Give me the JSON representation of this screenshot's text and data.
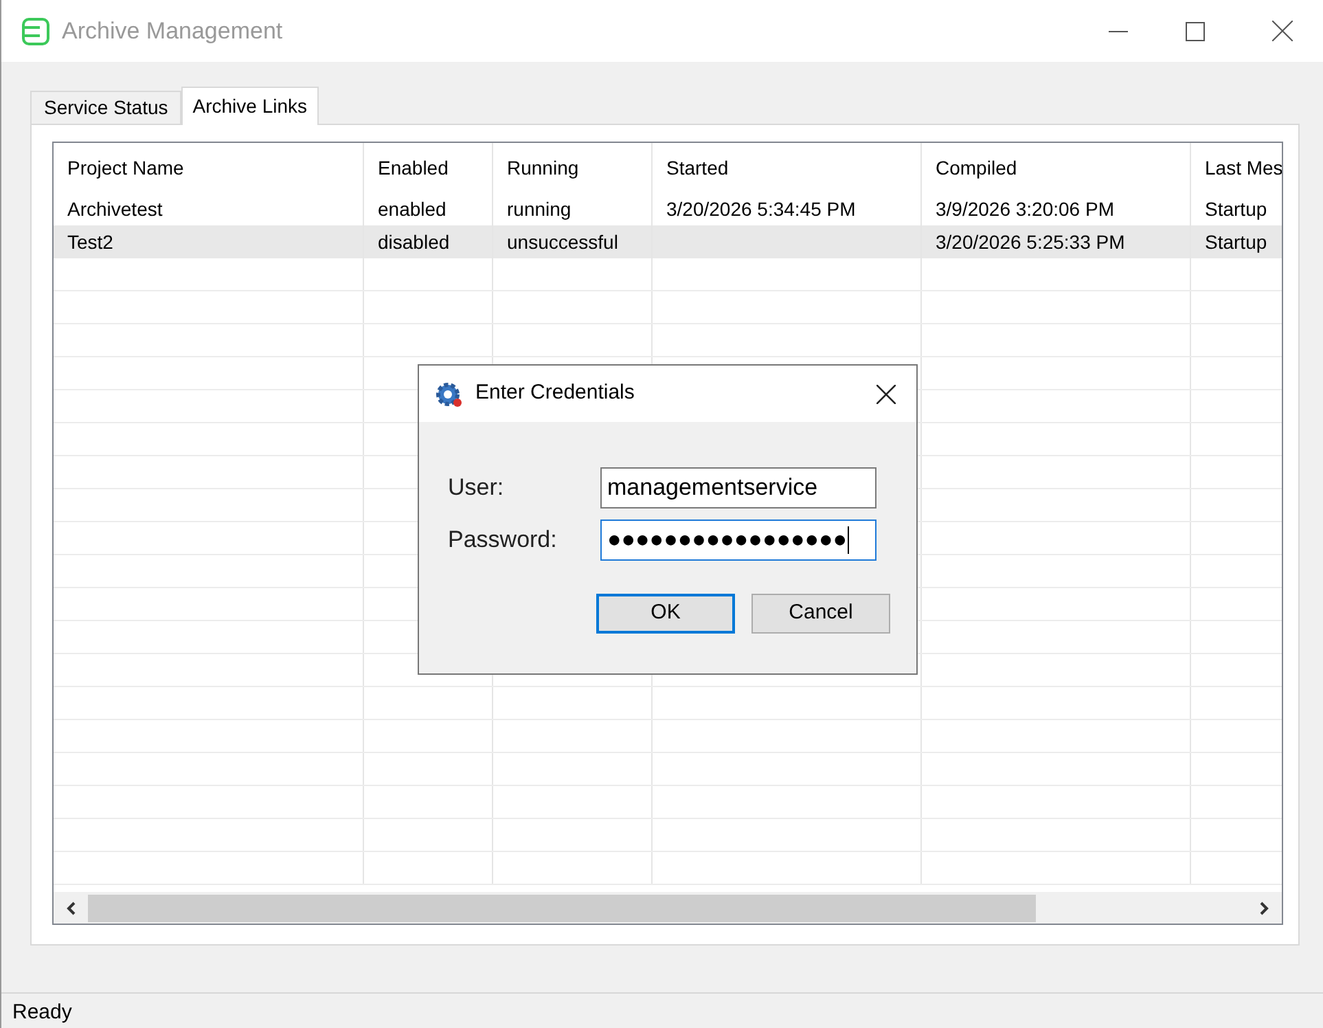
{
  "window": {
    "title": "Archive Management"
  },
  "tabs": [
    {
      "label": "Service Status",
      "selected": false
    },
    {
      "label": "Archive Links",
      "selected": true
    }
  ],
  "table": {
    "columns": [
      "Project Name",
      "Enabled",
      "Running",
      "Started",
      "Compiled",
      "Last Mes"
    ],
    "rows": [
      {
        "cells": [
          "Archivetest",
          "enabled",
          "running",
          "3/20/2026 5:34:45 PM",
          "3/9/2026 3:20:06 PM",
          "Startup"
        ],
        "selected": false
      },
      {
        "cells": [
          "Test2",
          "disabled",
          "unsuccessful",
          "",
          "3/20/2026 5:25:33 PM",
          "Startup"
        ],
        "selected": true
      }
    ]
  },
  "dialog": {
    "title": "Enter Credentials",
    "fields": [
      {
        "label": "User:",
        "value": "managementservice",
        "focused": false
      },
      {
        "label": "Password:",
        "value": "●●●●●●●●●●●●●●●●●",
        "focused": true
      }
    ],
    "buttons": [
      {
        "label": "OK",
        "default": true
      },
      {
        "label": "Cancel",
        "default": false
      }
    ]
  },
  "status_bar": {
    "text": "Ready"
  }
}
